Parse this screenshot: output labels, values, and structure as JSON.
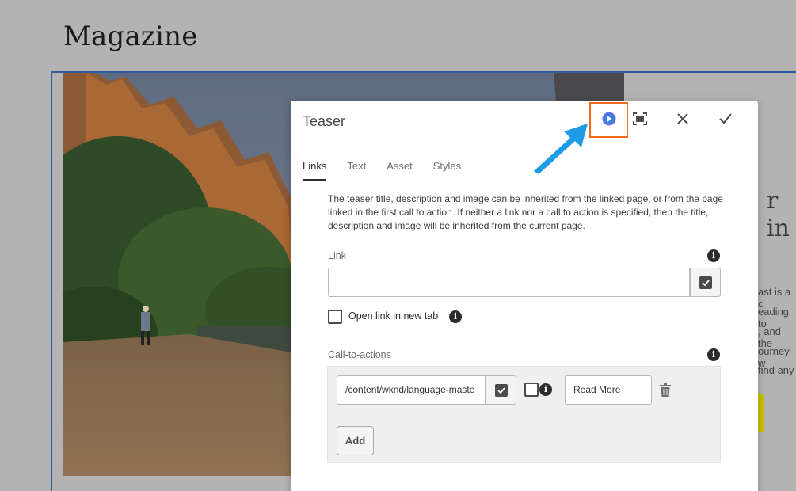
{
  "page": {
    "title": "Magazine",
    "side_heading_fragment": "r in",
    "side_text_lines": [
      "ast is a c",
      "eading to",
      ", and the",
      "ourney w",
      "find any"
    ]
  },
  "dialog": {
    "title": "Teaser",
    "header_icons": [
      "assistant-icon",
      "fullscreen-icon",
      "close-icon",
      "done-check-icon"
    ],
    "tabs": [
      {
        "label": "Links",
        "active": true
      },
      {
        "label": "Text",
        "active": false
      },
      {
        "label": "Asset",
        "active": false
      },
      {
        "label": "Styles",
        "active": false
      }
    ],
    "description": "The teaser title, description and image can be inherited from the linked page, or from the page linked in the first call to action. If neither a link nor a call to action is specified, then the title, description and image will be inherited from the current page.",
    "link": {
      "label": "Link",
      "value": ""
    },
    "open_new_tab": {
      "label": "Open link in new tab",
      "checked": false
    },
    "cta": {
      "label": "Call-to-actions",
      "items": [
        {
          "path": "/content/wknd/language-maste",
          "checked": false,
          "text": "Read More"
        }
      ],
      "add_label": "Add"
    }
  },
  "colors": {
    "highlight": "#f06a1a",
    "arrow": "#1e9be6",
    "frame": "#2f5f9f",
    "cta_accent": "#c9c100"
  }
}
